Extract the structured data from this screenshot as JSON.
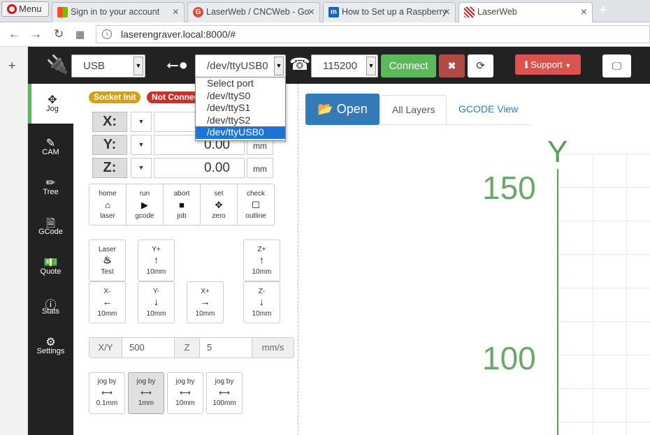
{
  "browser": {
    "menu_label": "Menu",
    "tabs": [
      {
        "label": "Sign in to your account",
        "favicon_color": "#f25022"
      },
      {
        "label": "LaserWeb / CNCWeb - Go",
        "favicon_color": "#dd4b39"
      },
      {
        "label": "How to Set up a Raspberry",
        "favicon_color": "#1565c0"
      },
      {
        "label": "LaserWeb",
        "favicon_color": "#b22"
      }
    ],
    "url": "laserengraver.local:8000/#"
  },
  "appbar": {
    "interface_value": "USB",
    "port_value": "/dev/ttyUSB0",
    "baud_value": "115200",
    "connect_label": "Connect",
    "support_label": "Support"
  },
  "port_dropdown": {
    "options": [
      "Select port",
      "/dev/ttyS0",
      "/dev/ttyS1",
      "/dev/ttyS2",
      "/dev/ttyUSB0"
    ],
    "selected_index": 4
  },
  "nav": [
    {
      "label": "Jog",
      "icon": "arrows-icon"
    },
    {
      "label": "CAM",
      "icon": "edit-icon"
    },
    {
      "label": "Tree",
      "icon": "pencil-icon"
    },
    {
      "label": "GCode",
      "icon": "file-code-icon"
    },
    {
      "label": "Quote",
      "icon": "money-icon"
    },
    {
      "label": "Stats",
      "icon": "info-icon"
    },
    {
      "label": "Settings",
      "icon": "gears-icon"
    }
  ],
  "status": {
    "socket": "Socket Init",
    "socket_color": "#d4a017",
    "connection": "Not Connected",
    "connection_color": "#c9302c"
  },
  "axes": [
    {
      "label": "X:",
      "value": "",
      "unit": "mm"
    },
    {
      "label": "Y:",
      "value": "0.00",
      "unit": "mm"
    },
    {
      "label": "Z:",
      "value": "0.00",
      "unit": "mm"
    }
  ],
  "commands": [
    {
      "top": "home",
      "bottom": "laser",
      "icon": "home-icon"
    },
    {
      "top": "run",
      "bottom": "gcode",
      "icon": "play-icon"
    },
    {
      "top": "abort",
      "bottom": "job",
      "icon": "stop-icon"
    },
    {
      "top": "set",
      "bottom": "zero",
      "icon": "crosshair-icon"
    },
    {
      "top": "check",
      "bottom": "outline",
      "icon": "square-icon"
    }
  ],
  "jog_buttons": {
    "laser_test": {
      "top": "Laser",
      "bottom": "Test"
    },
    "y_plus": {
      "top": "Y+",
      "bottom": "10mm"
    },
    "z_plus": {
      "top": "Z+",
      "bottom": "10mm"
    },
    "x_minus": {
      "top": "X-",
      "bottom": "10mm"
    },
    "y_minus": {
      "top": "Y-",
      "bottom": "10mm"
    },
    "x_plus": {
      "top": "X+",
      "bottom": "10mm"
    },
    "z_minus": {
      "top": "Z-",
      "bottom": "10mm"
    }
  },
  "speed": {
    "xy_label": "X/Y",
    "xy_value": "500",
    "z_label": "Z",
    "z_value": "5",
    "unit": "mm/s"
  },
  "step_buttons": [
    {
      "top": "jog by",
      "bottom": "0.1mm",
      "active": false
    },
    {
      "top": "jog by",
      "bottom": "1mm",
      "active": true
    },
    {
      "top": "jog by",
      "bottom": "10mm",
      "active": false
    },
    {
      "top": "jog by",
      "bottom": "100mm",
      "active": false
    }
  ],
  "viewer": {
    "open_label": "Open",
    "tab_layers": "All Layers",
    "tab_gcode": "GCODE View",
    "axis_label": "Y",
    "tick_150": "150",
    "tick_100": "100",
    "axis_color": "#5a9e5a"
  }
}
